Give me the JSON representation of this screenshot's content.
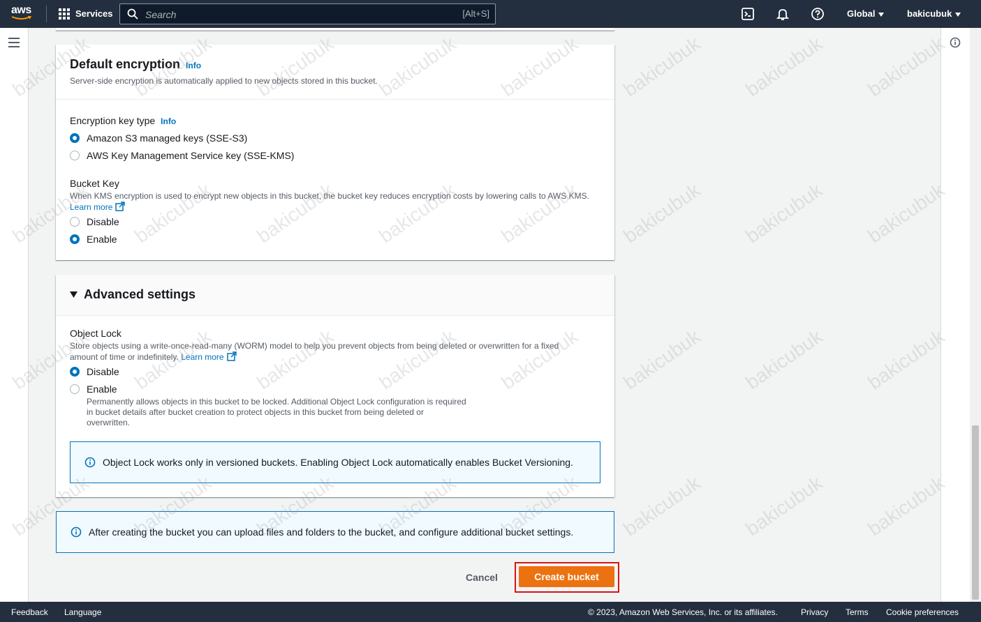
{
  "topbar": {
    "logo_text": "aws",
    "services_label": "Services",
    "search_placeholder": "Search",
    "search_shortcut": "[Alt+S]",
    "region_label": "Global",
    "account_label": "bakicubuk"
  },
  "default_encryption": {
    "title": "Default encryption",
    "info_label": "Info",
    "description": "Server-side encryption is automatically applied to new objects stored in this bucket.",
    "key_type_label": "Encryption key type",
    "key_type_info": "Info",
    "options": [
      {
        "label": "Amazon S3 managed keys (SSE-S3)",
        "checked": true
      },
      {
        "label": "AWS Key Management Service key (SSE-KMS)",
        "checked": false
      }
    ],
    "bucket_key": {
      "label": "Bucket Key",
      "description": "When KMS encryption is used to encrypt new objects in this bucket, the bucket key reduces encryption costs by lowering calls to AWS KMS.",
      "learn_more": "Learn more",
      "options": [
        {
          "label": "Disable",
          "checked": false
        },
        {
          "label": "Enable",
          "checked": true
        }
      ]
    }
  },
  "advanced_settings": {
    "title": "Advanced settings",
    "object_lock": {
      "label": "Object Lock",
      "description": "Store objects using a write-once-read-many (WORM) model to help you prevent objects from being deleted or overwritten for a fixed amount of time or indefinitely.",
      "learn_more": "Learn more",
      "options": [
        {
          "label": "Disable",
          "checked": true
        },
        {
          "label": "Enable",
          "checked": false,
          "description": "Permanently allows objects in this bucket to be locked. Additional Object Lock configuration is required in bucket details after bucket creation to protect objects in this bucket from being deleted or overwritten."
        }
      ]
    },
    "alert_text": "Object Lock works only in versioned buckets. Enabling Object Lock automatically enables Bucket Versioning."
  },
  "bottom_alert_text": "After creating the bucket you can upload files and folders to the bucket, and configure additional bucket settings.",
  "actions": {
    "cancel_label": "Cancel",
    "create_label": "Create bucket"
  },
  "footer": {
    "feedback": "Feedback",
    "language": "Language",
    "copyright": "© 2023, Amazon Web Services, Inc. or its affiliates.",
    "privacy": "Privacy",
    "terms": "Terms",
    "cookie_preferences": "Cookie preferences"
  },
  "watermark_text": "bakicubuk",
  "colors": {
    "topbar_bg": "#232f3e",
    "link": "#0073bb",
    "primary_button": "#ec7211",
    "highlight_frame": "#d91515"
  }
}
